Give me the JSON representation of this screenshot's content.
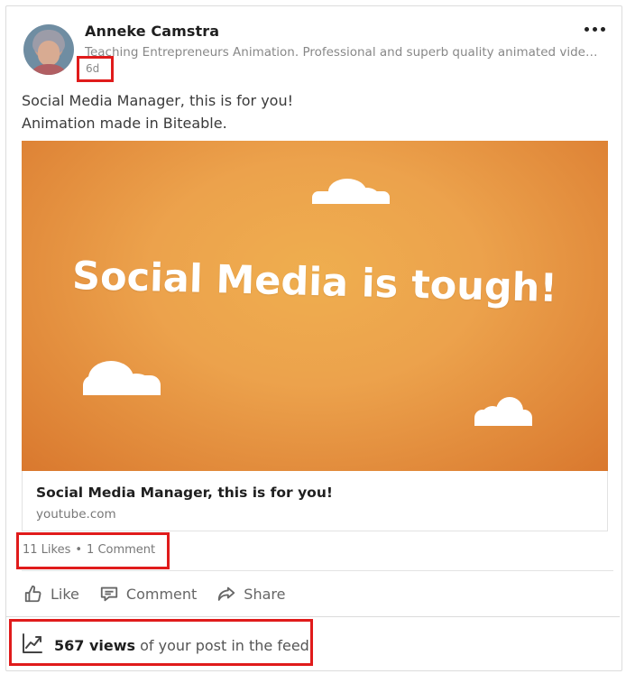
{
  "author": {
    "name": "Anneke Camstra",
    "headline": "Teaching Entrepreneurs Animation. Professional and superb quality animated vide…",
    "time": "6d"
  },
  "post": {
    "line1": "Social Media Manager, this is for you!",
    "line2": "Animation made in Biteable."
  },
  "video": {
    "overlay_text": "Social Media is tough!"
  },
  "link": {
    "title": "Social Media Manager, this is for you!",
    "domain": "youtube.com"
  },
  "social": {
    "likes": "11 Likes",
    "separator": "•",
    "comments": "1 Comment"
  },
  "actions": {
    "like": "Like",
    "comment": "Comment",
    "share": "Share"
  },
  "views": {
    "count": "567 views",
    "suffix": " of your post in the feed"
  },
  "icons": [
    "more-icon",
    "like-icon",
    "comment-icon",
    "share-icon",
    "analytics-icon"
  ],
  "colors": {
    "highlight": "#e01b1b",
    "video_bg": "#eca24c"
  }
}
